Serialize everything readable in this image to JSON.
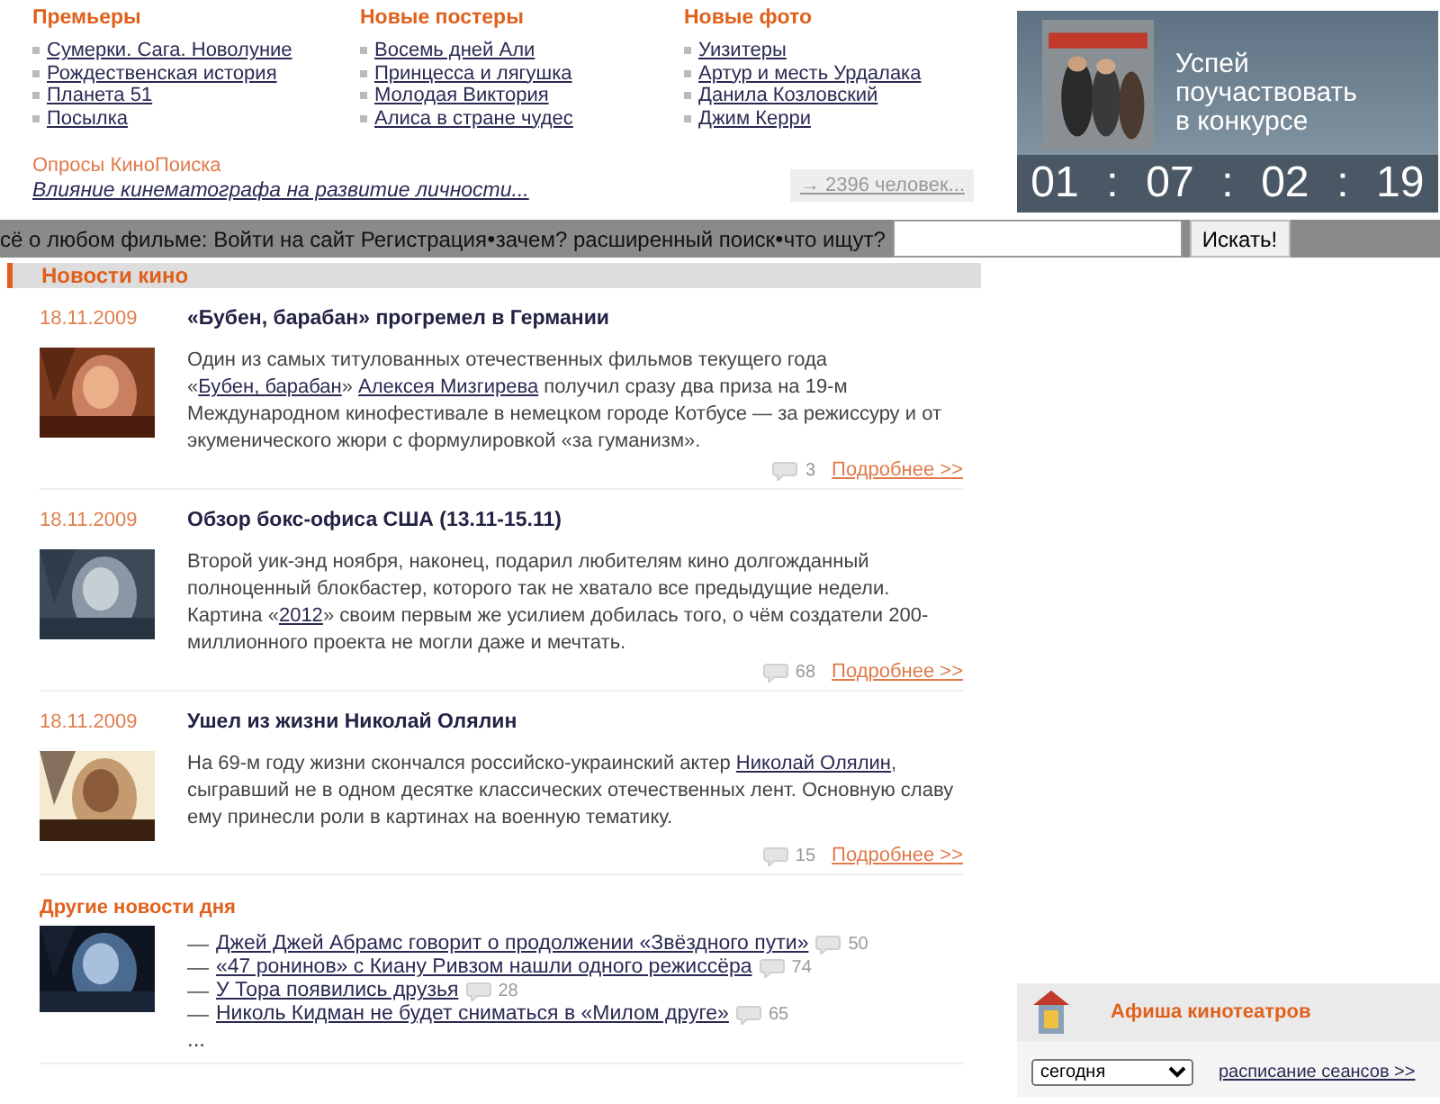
{
  "top_lists": [
    {
      "title": "Премьеры",
      "items": [
        "Сумерки. Сага. Новолуние",
        "Рождественская история",
        "Планета 51",
        "Посылка"
      ]
    },
    {
      "title": "Новые постеры",
      "items": [
        "Восемь дней Али",
        "Принцесса и лягушка",
        "Молодая Виктория",
        "Алиса в стране чудес"
      ]
    },
    {
      "title": "Новые фото",
      "items": [
        "Уизитеры",
        "Артур и месть Урдалака",
        "Данила Козловский",
        "Джим Керри"
      ]
    }
  ],
  "poll": {
    "label": "Опросы КиноПоиска",
    "question": "Влияние кинематографа на развитие личности...",
    "votes": "→ 2396 человек..."
  },
  "banner": {
    "headline": [
      "Успей",
      "поучаствовать",
      "в конкурсе"
    ],
    "countdown": [
      "01",
      "07",
      "02",
      "19"
    ],
    "separator": ":"
  },
  "search_bar": {
    "tagline": "сё о любом фильме:",
    "links": [
      "Войти на сайт",
      "Регистрация",
      "зачем?",
      "расширенный поиск",
      "что ищут?"
    ],
    "dot": "●",
    "button": "Искать!"
  },
  "news_heading": "Новости кино",
  "news": [
    {
      "date": "18.11.2009",
      "title": "«Бубен, барабан» прогремел в Германии",
      "body": [
        {
          "text": "Один из самых титулованных отечественных фильмов текущего года «",
          "link": false
        },
        {
          "text": "Бубен, барабан",
          "link": true
        },
        {
          "text": "» ",
          "link": false
        },
        {
          "text": "Алексея Мизгирева",
          "link": true
        },
        {
          "text": " получил сразу два приза на 19-м Международном кинофестивале в немецком городе Котбусе — за режиссуру и от экуменического жюри с формулировкой «за гуманизм».",
          "link": false
        }
      ],
      "comments": "3",
      "more": "Подробнее >>"
    },
    {
      "date": "18.11.2009",
      "title": "Обзор бокс-офиса США (13.11-15.11)",
      "body": [
        {
          "text": "Второй уик-энд ноября, наконец, подарил любителям кино долгожданный полноценный блокбастер, которого так не хватало все предыдущие недели. Картина «",
          "link": false
        },
        {
          "text": "2012",
          "link": true
        },
        {
          "text": "» своим первым же усилием добилась того, о чём создатели 200-миллионного проекта не могли даже и мечтать.",
          "link": false
        }
      ],
      "comments": "68",
      "more": "Подробнее >>"
    },
    {
      "date": "18.11.2009",
      "title": "Ушел из жизни Николай Олялин",
      "body": [
        {
          "text": "На 69-м году жизни скончался российско-украинский актер ",
          "link": false
        },
        {
          "text": "Николай Олялин",
          "link": true
        },
        {
          "text": ", сыгравший не в одном десятке классических отечественных лент. Основную славу ему принесли роли в картинах на военную тематику.",
          "link": false
        }
      ],
      "comments": "15",
      "more": "Подробнее >>"
    }
  ],
  "other_news": {
    "title": "Другие новости дня",
    "dash": "—",
    "items": [
      {
        "title": "Джей Джей Абрамс говорит о продолжении «Звёздного пути»",
        "comments": "50"
      },
      {
        "title": "«47 ронинов» с Киану Ривзом нашли одного режиссёра",
        "comments": "74"
      },
      {
        "title": "У Тора появились друзья",
        "comments": "28"
      },
      {
        "title": "Николь Кидман не будет сниматься в «Милом друге»",
        "comments": "65"
      }
    ],
    "more": "..."
  },
  "cinema_widget": {
    "title": "Афиша кинотеатров",
    "day": "сегодня",
    "link": "расписание сеансов >>"
  }
}
